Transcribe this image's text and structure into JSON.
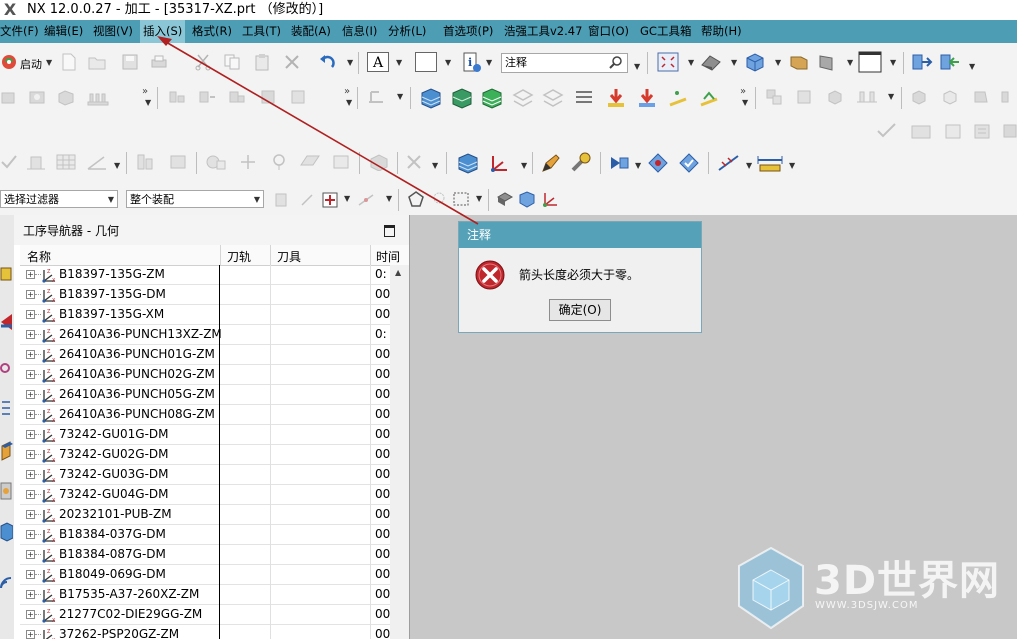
{
  "window": {
    "title": "NX 12.0.0.27 - 加工 - [35317-XZ.prt （修改的）]"
  },
  "menubar": {
    "items": [
      {
        "label": "文件(F)"
      },
      {
        "label": "编辑(E)"
      },
      {
        "label": "视图(V)"
      },
      {
        "label": "插入(S)"
      },
      {
        "label": "格式(R)"
      },
      {
        "label": "工具(T)"
      },
      {
        "label": "装配(A)"
      },
      {
        "label": "信息(I)"
      },
      {
        "label": "分析(L)"
      },
      {
        "label": "首选项(P)"
      },
      {
        "label": "浩强工具v2.47"
      },
      {
        "label": "窗口(O)"
      },
      {
        "label": "GC工具箱"
      },
      {
        "label": "帮助(H)"
      }
    ]
  },
  "toolbar": {
    "start_label": "启动",
    "search_value": "注释",
    "filter_select": "选择过滤器",
    "scope_select": "整个装配"
  },
  "navigator": {
    "title": "工序导航器 - 几何",
    "columns": [
      "名称",
      "刀轨",
      "刀具",
      "时间"
    ],
    "rows": [
      {
        "name": "B18397-135G-ZM",
        "time": "0:"
      },
      {
        "name": "B18397-135G-DM",
        "time": "00"
      },
      {
        "name": "B18397-135G-XM",
        "time": "00"
      },
      {
        "name": "26410A36-PUNCH13XZ-ZM",
        "time": "0:"
      },
      {
        "name": "26410A36-PUNCH01G-ZM",
        "time": "00"
      },
      {
        "name": "26410A36-PUNCH02G-ZM",
        "time": "00"
      },
      {
        "name": "26410A36-PUNCH05G-ZM",
        "time": "00"
      },
      {
        "name": "26410A36-PUNCH08G-ZM",
        "time": "00"
      },
      {
        "name": "73242-GU01G-DM",
        "time": "00"
      },
      {
        "name": "73242-GU02G-DM",
        "time": "00"
      },
      {
        "name": "73242-GU03G-DM",
        "time": "00"
      },
      {
        "name": "73242-GU04G-DM",
        "time": "00"
      },
      {
        "name": "20232101-PUB-ZM",
        "time": "00"
      },
      {
        "name": "B18384-037G-DM",
        "time": "00"
      },
      {
        "name": "B18384-087G-DM",
        "time": "00"
      },
      {
        "name": "B18049-069G-DM",
        "time": "00"
      },
      {
        "name": "B17535-A37-260XZ-ZM",
        "time": "00"
      },
      {
        "name": "21277C02-DIE29GG-ZM",
        "time": "00"
      },
      {
        "name": "37262-PSP20GZ-ZM",
        "time": "00"
      }
    ]
  },
  "dialog": {
    "title": "注释",
    "message": "箭头长度必须大于零。",
    "ok_label": "确定(O)"
  },
  "watermark": {
    "brand": "3D世界网",
    "url": "WWW.3DSJW.COM"
  },
  "colors": {
    "menubar_bg": "#4d9db5",
    "dialog_title_bg": "#55a1b7",
    "error_red": "#c0272d",
    "annotation_arrow": "#b02020"
  }
}
